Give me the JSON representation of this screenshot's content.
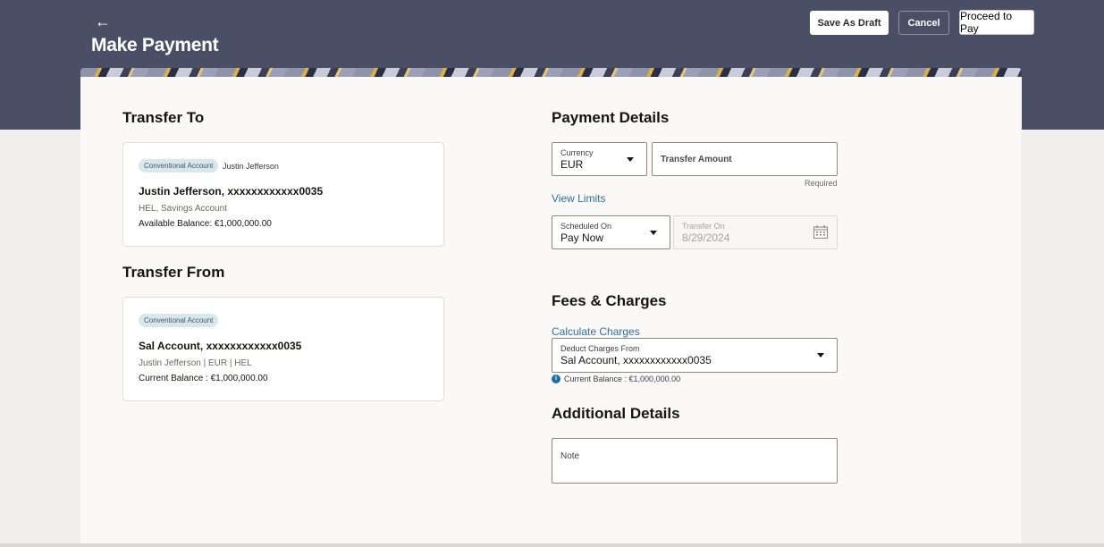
{
  "header": {
    "back_icon": "back-arrow-icon",
    "back_glyph": "←",
    "title": "Make Payment",
    "save_draft_label": "Save As Draft",
    "cancel_label": "Cancel",
    "proceed_label": "Proceed to Pay"
  },
  "transfer_to": {
    "title": "Transfer To",
    "badge": "Conventional Account",
    "badge_name": "Justin Jefferson",
    "account_name": "Justin Jefferson, xxxxxxxxxxxx0035",
    "account_sub": "HEL, Savings Account",
    "balance": "Available Balance: €1,000,000.00"
  },
  "transfer_from": {
    "title": "Transfer From",
    "badge": "Conventional Account",
    "account_name": "Sal Account, xxxxxxxxxxxx0035",
    "account_sub": "Justin Jefferson | EUR | HEL",
    "balance": "Current Balance : €1,000,000.00"
  },
  "payment_details": {
    "title": "Payment Details",
    "currency_label": "Currency",
    "currency_value": "EUR",
    "amount_placeholder": "Transfer Amount",
    "required_text": "Required",
    "view_limits": "View Limits",
    "scheduled_label": "Scheduled On",
    "scheduled_value": "Pay Now",
    "transfer_on_label": "Transfer On",
    "transfer_on_value": "8/29/2024",
    "calendar_icon": "calendar-icon"
  },
  "fees": {
    "title": "Fees & Charges",
    "calculate_link": "Calculate Charges",
    "deduct_label": "Deduct Charges From",
    "deduct_value": "Sal Account, xxxxxxxxxxxx0035",
    "info_icon": "info-icon",
    "info_glyph": "i",
    "info_text": "Current Balance : €1,000,000.00"
  },
  "additional": {
    "title": "Additional Details",
    "note_placeholder": "Note"
  },
  "colors": {
    "header_bg": "#4b4f66",
    "link": "#2e6da4",
    "badge_bg": "#d8e6ee",
    "info_icon": "#1c6ea4"
  }
}
